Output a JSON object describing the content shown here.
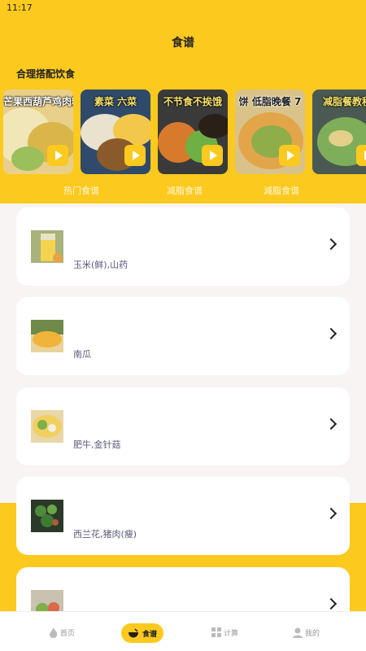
{
  "status_bar": {
    "time": "11:17"
  },
  "header": {
    "title": "食谱"
  },
  "section": {
    "title": "合理搭配饮食"
  },
  "videos": [
    {
      "caption": "芒果西葫芦鸡肉粉丝",
      "icon": "play-icon"
    },
    {
      "caption": "素菜 六菜",
      "icon": "play-icon"
    },
    {
      "caption": "不节食不挨饿",
      "icon": "play-icon"
    },
    {
      "caption": "饼 低脂晚餐 7",
      "icon": "play-icon"
    },
    {
      "caption": "减脂餐教程",
      "icon": "play-icon"
    }
  ],
  "categories": [
    "热门食谱",
    "减脂食谱",
    "減脂食谱"
  ],
  "recipes": [
    {
      "ingredients": "玉米(鲜),山药"
    },
    {
      "ingredients": "南瓜"
    },
    {
      "ingredients": "肥牛,金针菇"
    },
    {
      "ingredients": "西兰花,猪肉(瘦)"
    },
    {
      "ingredients": ""
    }
  ],
  "tabbar": {
    "home": "首页",
    "recipes": "食谱",
    "calc": "计算",
    "mine": "我的"
  },
  "colors": {
    "accent": "#fcc91e",
    "background": "#f7f4f3"
  }
}
